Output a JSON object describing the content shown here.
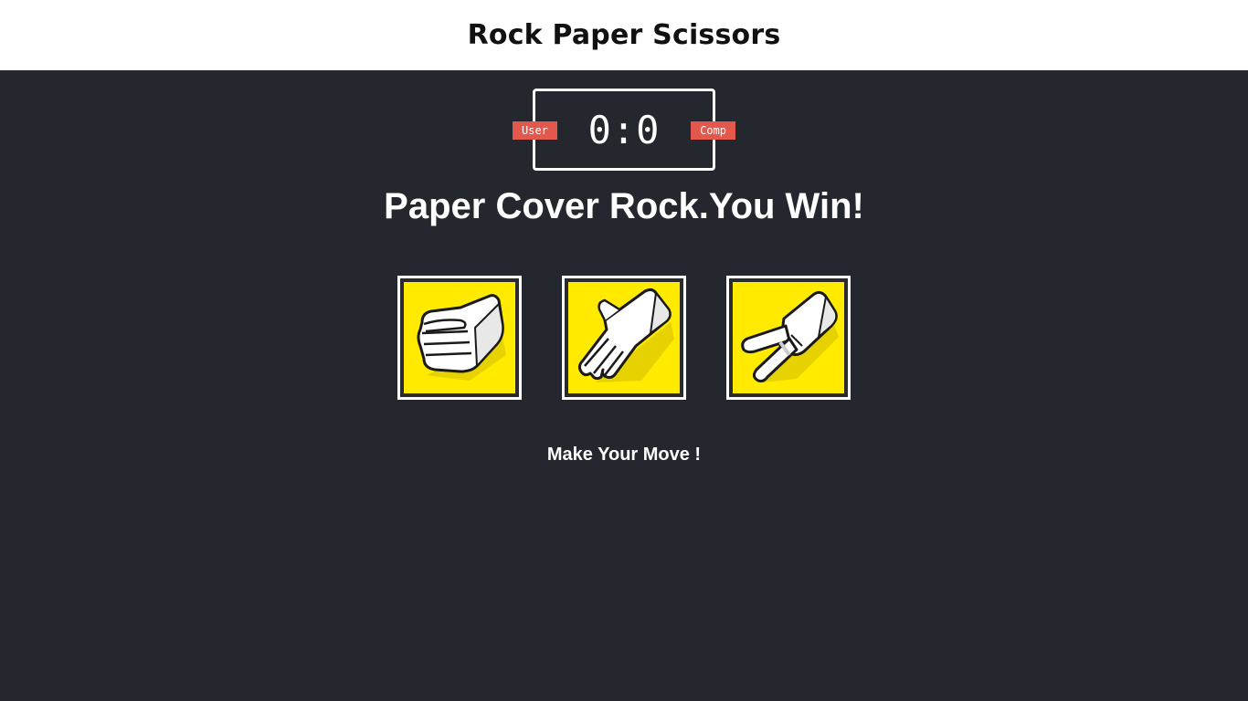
{
  "header": {
    "title": "Rock Paper Scissors"
  },
  "scoreboard": {
    "score": "0:0",
    "user_label": "User",
    "comp_label": "Comp"
  },
  "result": {
    "message": "Paper Cover Rock.You Win!"
  },
  "choices": [
    {
      "id": "r",
      "icon": "rock-hand-icon"
    },
    {
      "id": "p",
      "icon": "paper-hand-icon"
    },
    {
      "id": "s",
      "icon": "scissors-hand-icon"
    }
  ],
  "action": {
    "message": "Make Your Move !"
  },
  "colors": {
    "header_bg": "#ffffff",
    "page_bg": "#24272e",
    "badge": "#e2584d",
    "choice_bg": "#ffea00"
  }
}
